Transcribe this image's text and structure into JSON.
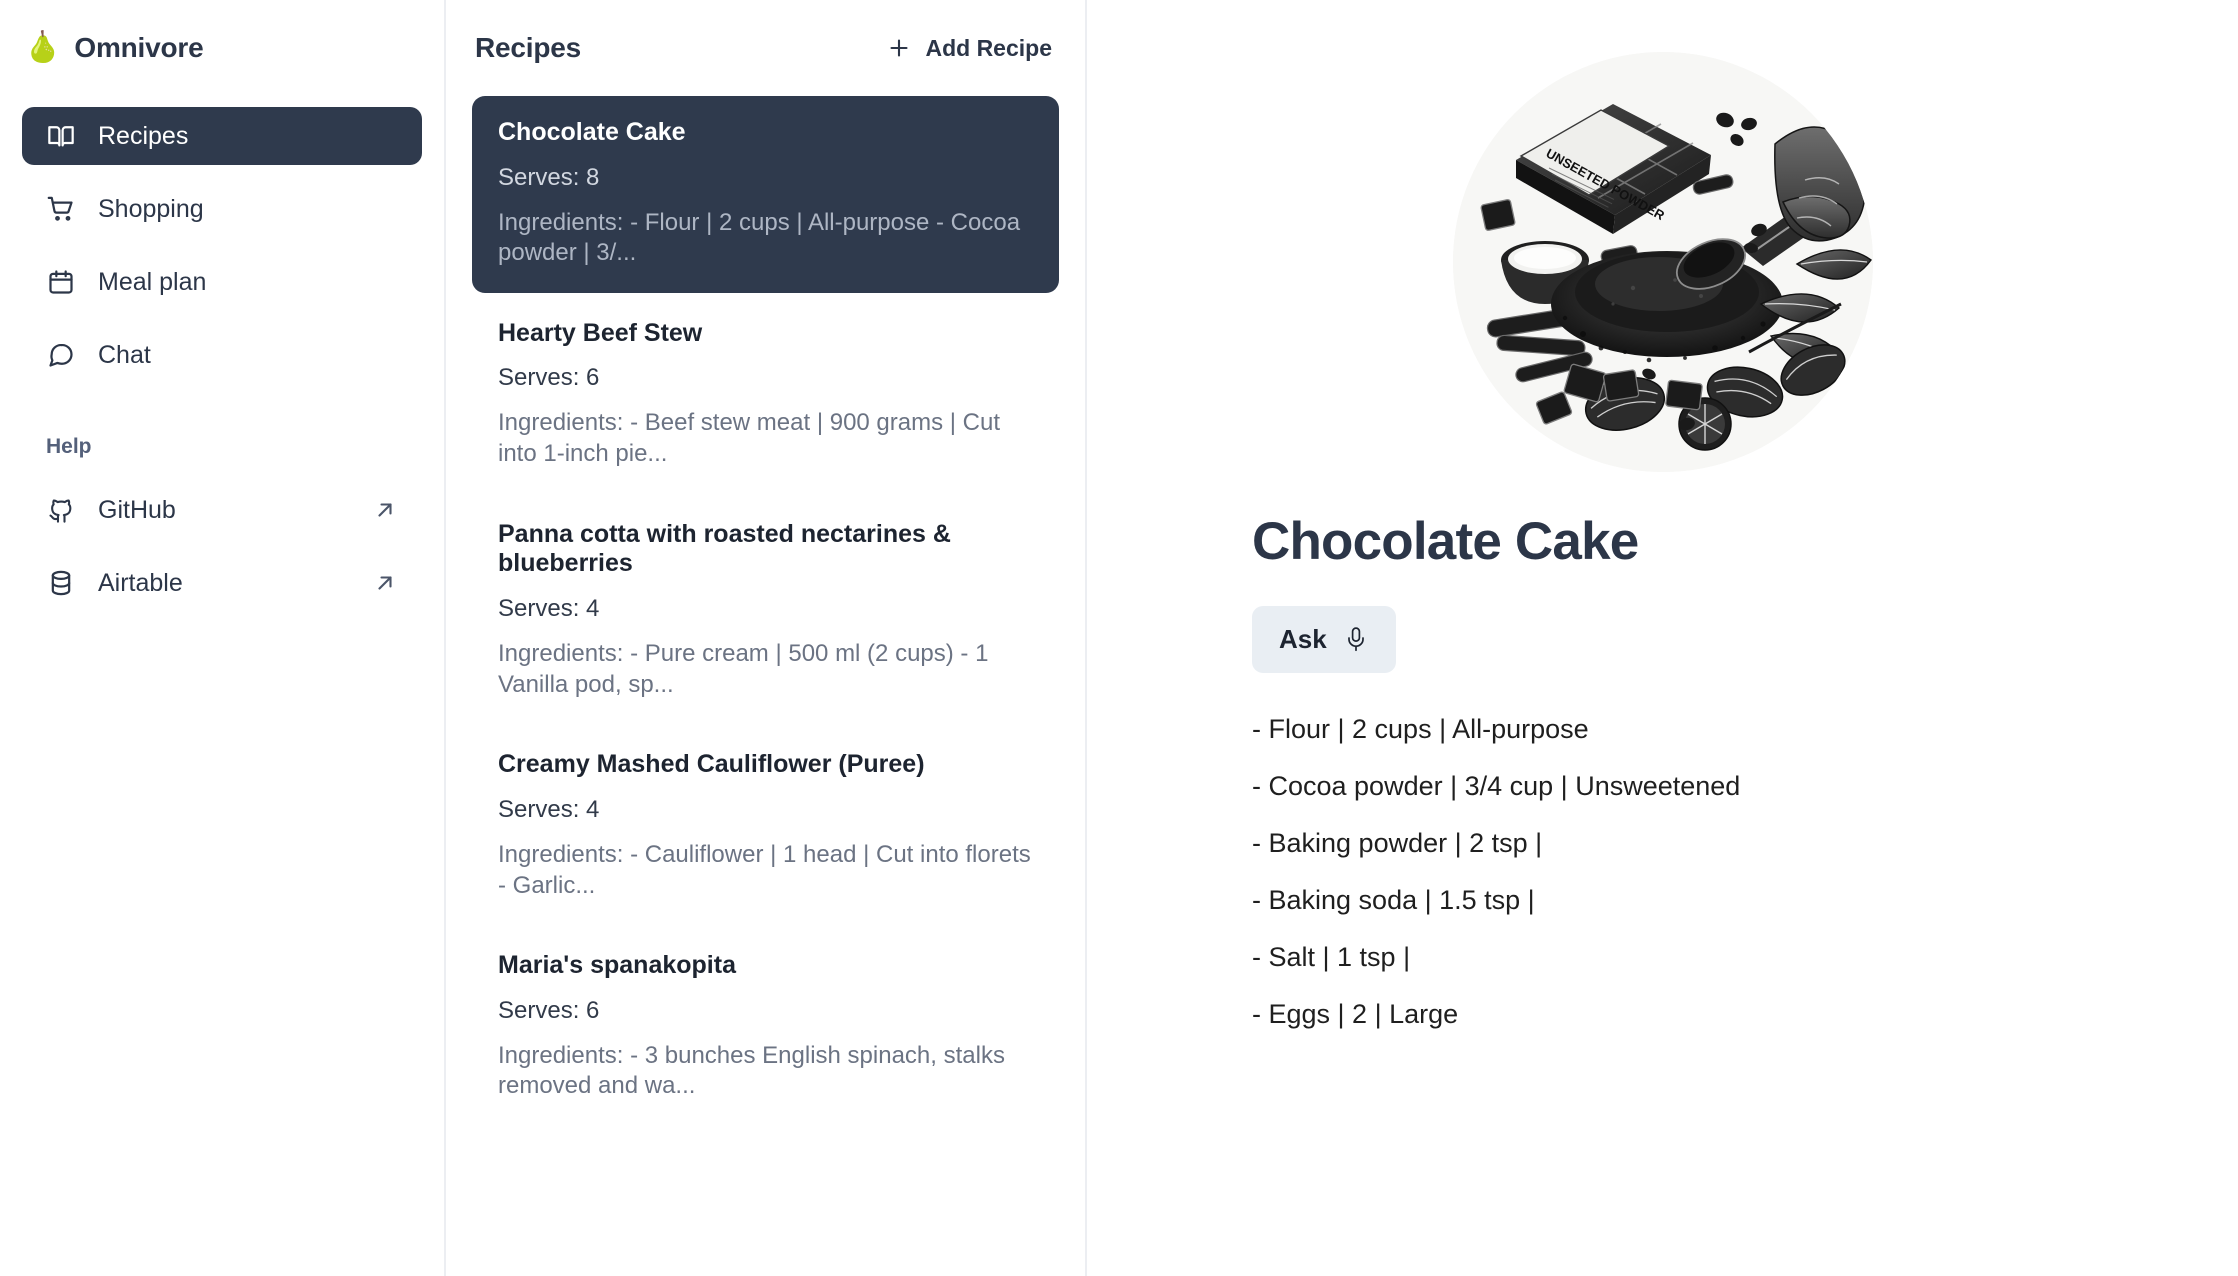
{
  "brand": {
    "logo_icon": "pear-icon",
    "logo_glyph": "🍐",
    "name": "Omnivore"
  },
  "sidebar": {
    "items": [
      {
        "label": "Recipes",
        "icon": "book-open-icon",
        "active": true
      },
      {
        "label": "Shopping",
        "icon": "shopping-cart-icon",
        "active": false
      },
      {
        "label": "Meal plan",
        "icon": "calendar-icon",
        "active": false
      },
      {
        "label": "Chat",
        "icon": "message-circle-icon",
        "active": false
      }
    ],
    "help_section_title": "Help",
    "help_items": [
      {
        "label": "GitHub",
        "icon": "github-icon",
        "external_icon": "external-link-arrow-icon"
      },
      {
        "label": "Airtable",
        "icon": "database-icon",
        "external_icon": "external-link-arrow-icon"
      }
    ]
  },
  "list": {
    "title": "Recipes",
    "add_label": "Add Recipe",
    "add_icon": "plus-icon",
    "recipes": [
      {
        "name": "Chocolate Cake",
        "serves": "Serves: 8",
        "ingredients": "Ingredients: - Flour | 2 cups | All-purpose - Cocoa powder | 3/...",
        "selected": true
      },
      {
        "name": "Hearty Beef Stew",
        "serves": "Serves: 6",
        "ingredients": "Ingredients: - Beef stew meat | 900 grams | Cut into 1-inch pie...",
        "selected": false
      },
      {
        "name": "Panna cotta with roasted nectarines & blueberries",
        "serves": "Serves: 4",
        "ingredients": "Ingredients: - Pure cream | 500 ml (2 cups) - 1 Vanilla pod, sp...",
        "selected": false
      },
      {
        "name": "Creamy Mashed Cauliflower (Puree)",
        "serves": "Serves: 4",
        "ingredients": "Ingredients: - Cauliflower | 1 head | Cut into florets - Garlic...",
        "selected": false
      },
      {
        "name": "Maria's spanakopita",
        "serves": "Serves: 6",
        "ingredients": "Ingredients: - 3 bunches English spinach, stalks removed and wa...",
        "selected": false
      }
    ]
  },
  "detail": {
    "image_alt": "cocoa-powder-illustration",
    "image_label_text": "UNSEETED POWDER",
    "title": "Chocolate Cake",
    "ask_label": "Ask",
    "ask_icon": "microphone-icon",
    "ingredients": [
      "- Flour | 2 cups | All-purpose",
      "- Cocoa powder | 3/4 cup | Unsweetened",
      "- Baking powder | 2 tsp |",
      "- Baking soda | 1.5 tsp |",
      "- Salt | 1 tsp |",
      "- Eggs | 2 | Large"
    ]
  },
  "colors": {
    "accent_dark": "#2f3a4d",
    "text_primary": "#2c3648",
    "text_muted": "#6b7383",
    "divider": "#eceef2",
    "ask_button_bg": "#e9eef3"
  }
}
